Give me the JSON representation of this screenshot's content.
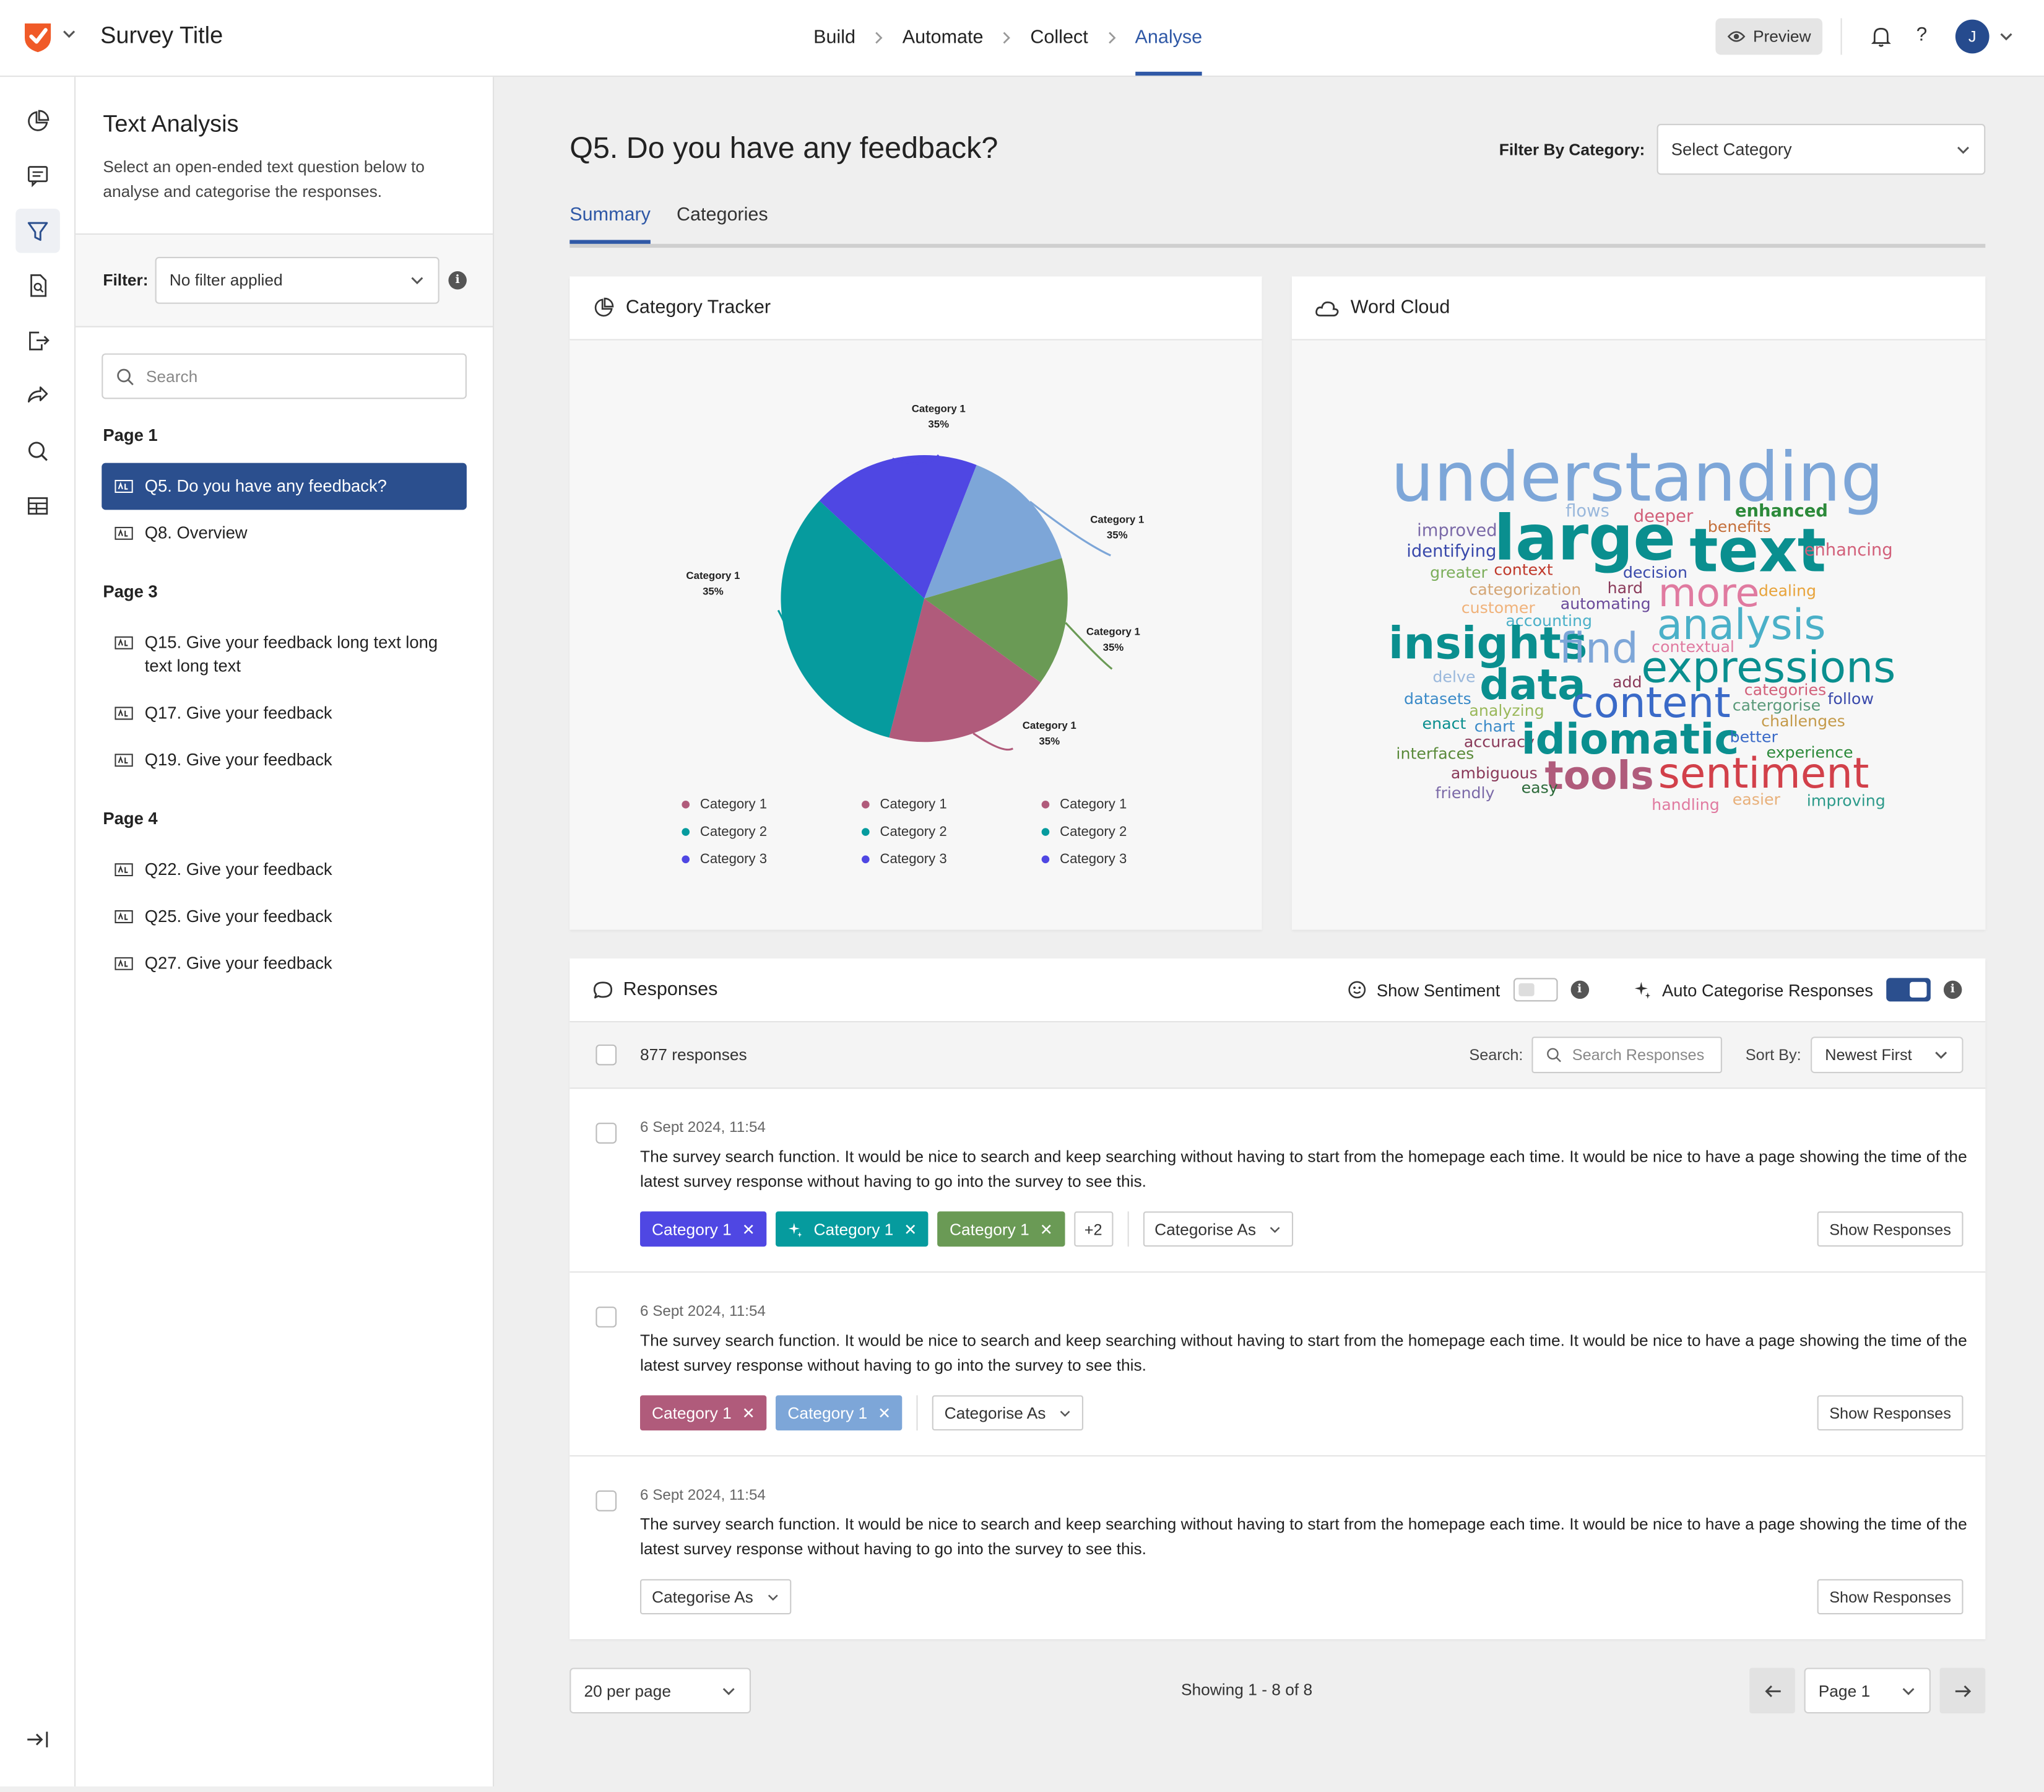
{
  "app": {
    "survey_title": "Survey Title"
  },
  "nav": {
    "steps": [
      "Build",
      "Automate",
      "Collect",
      "Analyse"
    ],
    "active_step": "Analyse",
    "preview_label": "Preview",
    "help_label": "?",
    "avatar_initial": "J"
  },
  "sidebar": {
    "title": "Text Analysis",
    "description": "Select an open-ended text question below to analyse and categorise the responses.",
    "filter_label": "Filter:",
    "filter_value": "No filter applied",
    "info_glyph": "i",
    "search_placeholder": "Search",
    "pages": [
      {
        "label": "Page 1",
        "questions": [
          "Q5. Do you have any feedback?",
          "Q8. Overview"
        ]
      },
      {
        "label": "Page 3",
        "questions": [
          "Q15. Give your feedback long text long text long text",
          "Q17. Give your feedback",
          "Q19. Give your feedback"
        ]
      },
      {
        "label": "Page 4",
        "questions": [
          "Q22. Give your feedback",
          "Q25. Give your feedback",
          "Q27. Give your feedback"
        ]
      }
    ],
    "active_question": "Q5. Do you have any feedback?"
  },
  "main": {
    "question_title": "Q5. Do you have any feedback?",
    "filter_category_label": "Filter By Category:",
    "filter_category_placeholder": "Select Category",
    "tabs": [
      "Summary",
      "Categories"
    ],
    "active_tab": "Summary"
  },
  "category_tracker": {
    "title": "Category Tracker",
    "legend": [
      [
        "Category 1",
        "Category 1",
        "Category 1"
      ],
      [
        "Category 2",
        "Category 2",
        "Category 2"
      ],
      [
        "Category 3",
        "Category 3",
        "Category 3"
      ]
    ],
    "legend_colors": [
      "#b05b7b",
      "#069b9e",
      "#4f47e3"
    ]
  },
  "chart_data": {
    "type": "pie",
    "slices": [
      {
        "label": "Category 1",
        "pct_label": "35%",
        "value": 19,
        "color": "#4f47e3"
      },
      {
        "label": "Category 1",
        "pct_label": "35%",
        "value": 14.5,
        "color": "#7da6d8"
      },
      {
        "label": "Category 1",
        "pct_label": "35%",
        "value": 14.5,
        "color": "#6a9a55"
      },
      {
        "label": "Category 1",
        "pct_label": "35%",
        "value": 19,
        "color": "#b05b7b"
      },
      {
        "label": "Category 1",
        "pct_label": "35%",
        "value": 33,
        "color": "#069b9e"
      }
    ]
  },
  "word_cloud": {
    "title": "Word Cloud",
    "words": [
      {
        "text": "understanding",
        "color": "#7da6d8"
      },
      {
        "text": "flows",
        "color": "#9ab8dc"
      },
      {
        "text": "deeper",
        "color": "#d2607a"
      },
      {
        "text": "enhanced",
        "color": "#2c8a3a"
      },
      {
        "text": "improved",
        "color": "#7b6aa8"
      },
      {
        "text": "large",
        "color": "#0a8f8f"
      },
      {
        "text": "benefits",
        "color": "#c46f3a"
      },
      {
        "text": "identifying",
        "color": "#3949ab"
      },
      {
        "text": "text",
        "color": "#0a8f8f"
      },
      {
        "text": "enhancing",
        "color": "#d2607a"
      },
      {
        "text": "greater",
        "color": "#7bae5a"
      },
      {
        "text": "context",
        "color": "#c0392b"
      },
      {
        "text": "decision",
        "color": "#3949ab"
      },
      {
        "text": "categorization",
        "color": "#d4a574"
      },
      {
        "text": "hard",
        "color": "#8a3a5a"
      },
      {
        "text": "more",
        "color": "#e07aa0"
      },
      {
        "text": "dealing",
        "color": "#e8a33a"
      },
      {
        "text": "customer",
        "color": "#f0b27a"
      },
      {
        "text": "automating",
        "color": "#6a4a9a"
      },
      {
        "text": "accounting",
        "color": "#4ab0c8"
      },
      {
        "text": "analysis",
        "color": "#4ab0c8"
      },
      {
        "text": "insights",
        "color": "#0a8f8f"
      },
      {
        "text": "find",
        "color": "#7da6d8"
      },
      {
        "text": "contextual",
        "color": "#e07aa0"
      },
      {
        "text": "expressions",
        "color": "#0a8f8f"
      },
      {
        "text": "delve",
        "color": "#9ab8dc"
      },
      {
        "text": "add",
        "color": "#8a3a5a"
      },
      {
        "text": "data",
        "color": "#0a8f8f"
      },
      {
        "text": "categories",
        "color": "#d2607a"
      },
      {
        "text": "datasets",
        "color": "#3a8ac8"
      },
      {
        "text": "content",
        "color": "#3a6ac8"
      },
      {
        "text": "follow",
        "color": "#3949ab"
      },
      {
        "text": "analyzing",
        "color": "#9ab85a"
      },
      {
        "text": "catergorise",
        "color": "#5a9a7a"
      },
      {
        "text": "enact",
        "color": "#0a8f8f"
      },
      {
        "text": "chart",
        "color": "#3a8ac8"
      },
      {
        "text": "challenges",
        "color": "#c49a4a"
      },
      {
        "text": "accuracy",
        "color": "#8a3a5a"
      },
      {
        "text": "idiomatic",
        "color": "#0a8f8f"
      },
      {
        "text": "better",
        "color": "#3a6ac8"
      },
      {
        "text": "interfaces",
        "color": "#5a8a3a"
      },
      {
        "text": "experience",
        "color": "#2c8a3a"
      },
      {
        "text": "ambiguous",
        "color": "#8a3a5a"
      },
      {
        "text": "tools",
        "color": "#b05b7b"
      },
      {
        "text": "sentiment",
        "color": "#d2404a"
      },
      {
        "text": "friendly",
        "color": "#7b6aa8"
      },
      {
        "text": "easy",
        "color": "#2c6a3a"
      },
      {
        "text": "handling",
        "color": "#e07aa0"
      },
      {
        "text": "easier",
        "color": "#e8b07a"
      },
      {
        "text": "improving",
        "color": "#2c9a8a"
      }
    ]
  },
  "responses": {
    "title": "Responses",
    "show_sentiment_label": "Show Sentiment",
    "show_sentiment_on": false,
    "auto_categorise_label": "Auto Categorise Responses",
    "auto_categorise_on": true,
    "count_label": "877 responses",
    "search_label": "Search:",
    "search_placeholder": "Search Responses",
    "sort_label": "Sort By:",
    "sort_value": "Newest First",
    "categorise_as_label": "Categorise As",
    "show_responses_label": "Show Responses",
    "remove_glyph": "✕",
    "items": [
      {
        "date": "6 Sept 2024, 11:54",
        "text": "The survey search function. It would be nice to search and keep searching without having to start from the homepage each time. It would be nice to have a page showing the time of the latest survey response without having to go into the survey to see this.",
        "tags": [
          {
            "label": "Category 1",
            "color": "#4f47e3",
            "ai": false
          },
          {
            "label": "Category 1",
            "color": "#069b9e",
            "ai": true
          },
          {
            "label": "Category 1",
            "color": "#6a9a55",
            "ai": false
          }
        ],
        "more": "+2"
      },
      {
        "date": "6 Sept 2024, 11:54",
        "text": "The survey search function. It would be nice to search and keep searching without having to start from the homepage each time. It would be nice to have a page showing the time of the latest survey response without having to go into the survey to see this.",
        "tags": [
          {
            "label": "Category 1",
            "color": "#b05b7b",
            "ai": false
          },
          {
            "label": "Category 1",
            "color": "#7da6d8",
            "ai": false
          }
        ],
        "more": ""
      },
      {
        "date": "6 Sept 2024, 11:54",
        "text": "The survey search function. It would be nice to search and keep searching without having to start from the homepage each time. It would be nice to have a page showing the time of the latest survey response without having to go into the survey to see this.",
        "tags": [],
        "more": ""
      }
    ]
  },
  "pagination": {
    "per_page": "20 per page",
    "showing": "Showing 1 - 8 of 8",
    "page_value": "Page 1"
  }
}
